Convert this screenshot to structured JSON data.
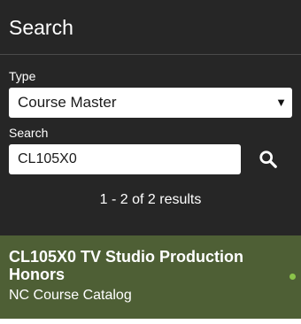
{
  "header": {
    "title": "Search"
  },
  "form": {
    "type_label": "Type",
    "type_value": "Course Master",
    "caret_icon": "caret-down-icon",
    "search_label": "Search",
    "search_value": "CL105X0",
    "search_icon": "search-icon"
  },
  "results": {
    "summary": "1 - 2 of 2 results",
    "items": [
      {
        "title": "CL105X0 TV Studio Production Honors",
        "subtitle": "NC Course Catalog",
        "status_color": "#8bc34a"
      }
    ]
  },
  "colors": {
    "panel_background": "#262626",
    "selected_item": "#4e5f35",
    "status_active": "#8bc34a"
  }
}
